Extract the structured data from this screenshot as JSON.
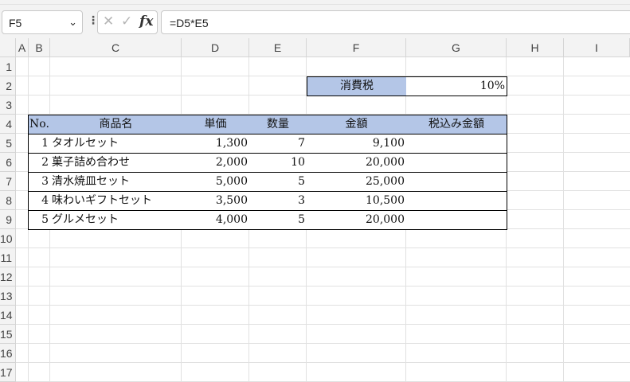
{
  "name_box": {
    "value": "F5"
  },
  "formula_bar": {
    "formula": "=D5*E5",
    "fx_label": "fx",
    "cancel_glyph": "✕",
    "enter_glyph": "✓",
    "dots": "⋮",
    "arrow": "⌄"
  },
  "columns": [
    "A",
    "B",
    "C",
    "D",
    "E",
    "F",
    "G",
    "H",
    "I"
  ],
  "rows": [
    "1",
    "2",
    "3",
    "4",
    "5",
    "6",
    "7",
    "8",
    "9",
    "10",
    "11",
    "12",
    "13",
    "14",
    "15",
    "16",
    "17"
  ],
  "tax": {
    "label": "消費税",
    "value": "10%"
  },
  "table": {
    "headers": [
      "No.",
      "商品名",
      "単価",
      "数量",
      "金額",
      "税込み金額"
    ],
    "rows": [
      [
        "1",
        "タオルセット",
        "1,300",
        "7",
        "9,100",
        ""
      ],
      [
        "2",
        "菓子詰め合わせ",
        "2,000",
        "10",
        "20,000",
        ""
      ],
      [
        "3",
        "清水焼皿セット",
        "5,000",
        "5",
        "25,000",
        ""
      ],
      [
        "4",
        "味わいギフトセット",
        "3,500",
        "3",
        "10,500",
        ""
      ],
      [
        "5",
        "グルメセット",
        "4,000",
        "5",
        "20,000",
        ""
      ]
    ]
  },
  "colors": {
    "header_fill": "#b4c6e7",
    "gridline": "#e1e1e1",
    "header_bg": "#f3f3f3"
  }
}
